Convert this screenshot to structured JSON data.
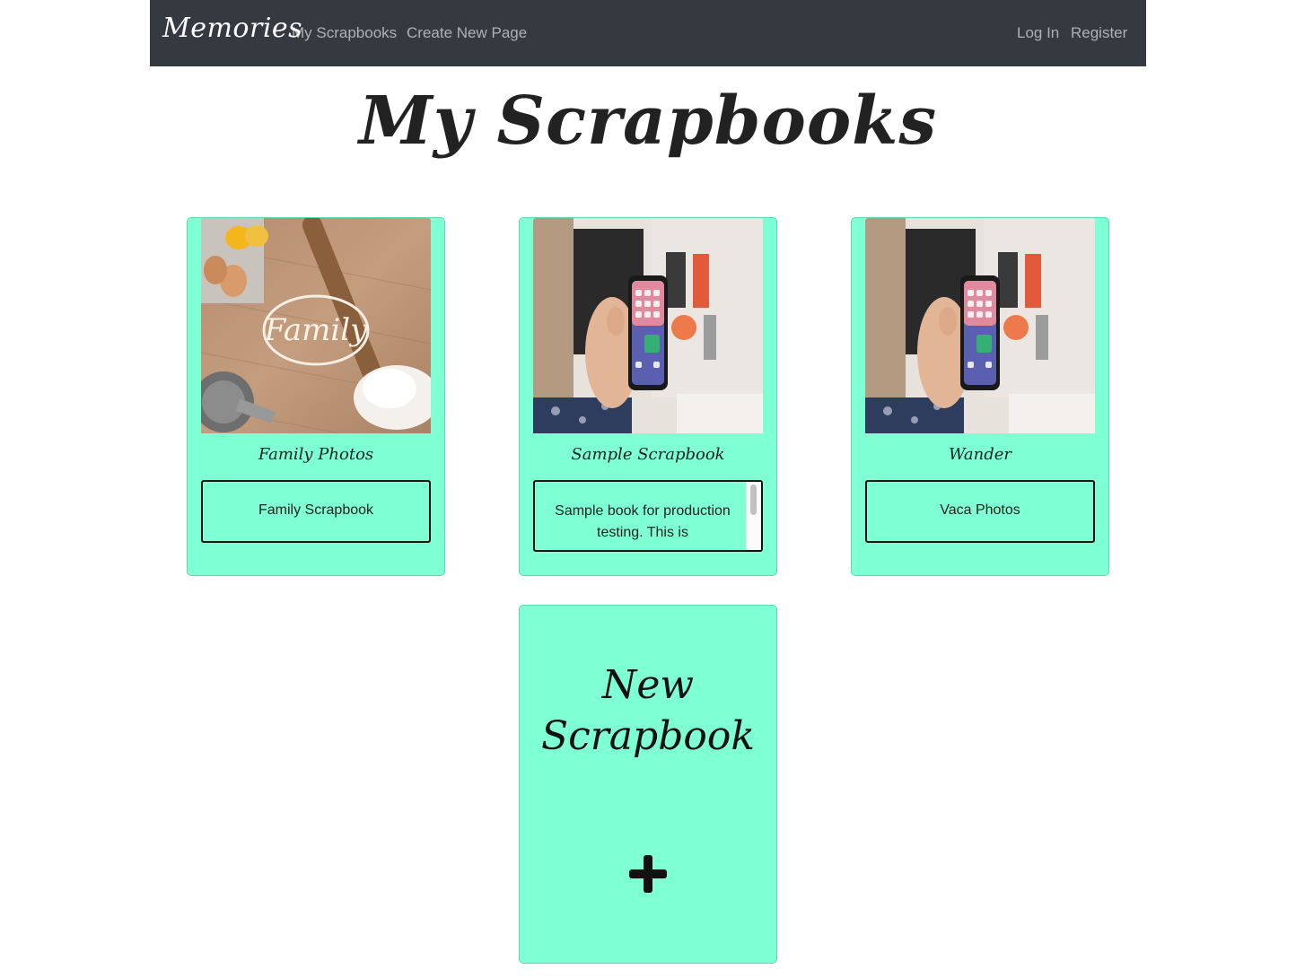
{
  "navbar": {
    "brand": "Memories",
    "links": [
      {
        "label": "My Scrapbooks"
      },
      {
        "label": "Create New Page"
      }
    ],
    "auth": {
      "login": "Log In",
      "register": "Register"
    },
    "background": "#343a40"
  },
  "page": {
    "title": "My Scrapbooks"
  },
  "scrapbooks": [
    {
      "title": "Family Photos",
      "description": "Family Scrapbook",
      "image": "family-flour-photo"
    },
    {
      "title": "Sample Scrapbook",
      "description": "Sample book for production testing. This is",
      "image": "phone-in-hand-photo"
    },
    {
      "title": "Wander",
      "description": "Vaca Photos",
      "image": "phone-in-hand-photo"
    }
  ],
  "new_card": {
    "title_line1": "New",
    "title_line2": "Scrapbook",
    "icon": "plus-icon"
  },
  "colors": {
    "card_bg": "#7fffd4",
    "accent": "#111111"
  }
}
